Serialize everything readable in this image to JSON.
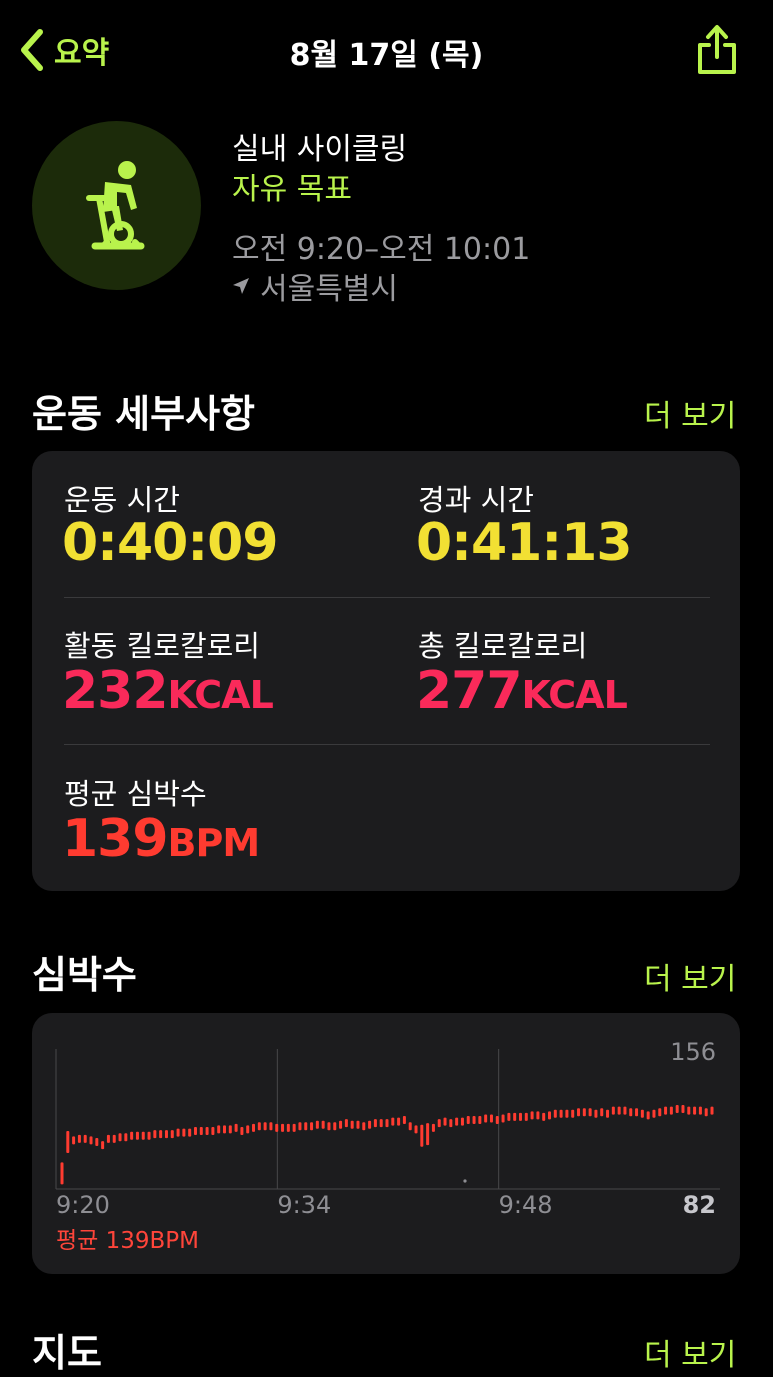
{
  "nav": {
    "back_label": "요약",
    "title": "8월 17일 (목)",
    "back_icon": "chevron-left-icon",
    "share_icon": "share-icon"
  },
  "workout": {
    "icon": "indoor-cycle-icon",
    "type": "실내 사이클링",
    "goal": "자유 목표",
    "time_range": "오전 9:20–오전 10:01",
    "location": "서울특별시"
  },
  "details": {
    "title": "운동 세부사항",
    "more": "더 보기",
    "metrics": [
      {
        "label": "운동 시간",
        "value": "0:40:09",
        "unit": ""
      },
      {
        "label": "경과 시간",
        "value": "0:41:13",
        "unit": ""
      },
      {
        "label": "활동 킬로칼로리",
        "value": "232",
        "unit": "KCAL"
      },
      {
        "label": "총 킬로칼로리",
        "value": "277",
        "unit": "KCAL"
      },
      {
        "label": "평균 심박수",
        "value": "139",
        "unit": "BPM"
      }
    ]
  },
  "heart_rate": {
    "title": "심박수",
    "more": "더 보기",
    "avg_label": "평균 139BPM"
  },
  "map": {
    "title": "지도",
    "more": "더 보기"
  },
  "colors": {
    "accent": "#b9f34c",
    "yellow": "#f2e033",
    "pink": "#fa2a5a",
    "red": "#ff3b30"
  },
  "chart_data": {
    "type": "bar",
    "x_tick_labels": [
      "9:20",
      "9:34",
      "9:48"
    ],
    "ylim": [
      82,
      156
    ],
    "y_max_label": "156",
    "y_min_label": "82",
    "values": [
      92,
      112,
      113,
      114,
      114,
      113,
      112,
      110,
      114,
      114,
      115,
      115,
      116,
      116,
      116,
      116,
      117,
      117,
      117,
      117,
      118,
      118,
      118,
      119,
      119,
      119,
      119,
      120,
      120,
      120,
      121,
      119,
      120,
      121,
      122,
      122,
      122,
      121,
      121,
      121,
      121,
      122,
      122,
      122,
      123,
      123,
      122,
      122,
      123,
      124,
      123,
      123,
      122,
      123,
      124,
      124,
      124,
      125,
      125,
      126,
      122,
      120,
      116,
      117,
      121,
      124,
      125,
      124,
      125,
      125,
      126,
      126,
      126,
      127,
      127,
      126,
      127,
      128,
      128,
      128,
      128,
      129,
      129,
      128,
      129,
      130,
      130,
      130,
      130,
      131,
      131,
      131,
      130,
      131,
      130,
      132,
      132,
      132,
      131,
      131,
      130,
      129,
      130,
      131,
      132,
      132,
      133,
      133,
      132,
      132,
      132,
      131,
      132
    ]
  }
}
